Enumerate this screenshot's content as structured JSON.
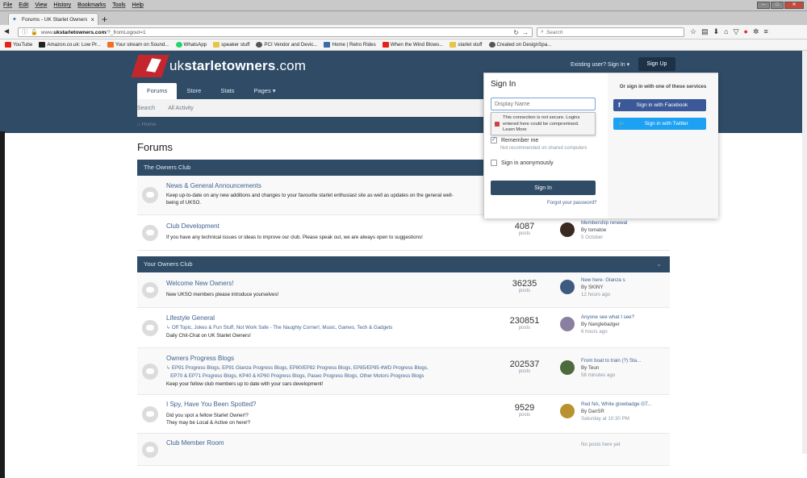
{
  "browser": {
    "menus": [
      "File",
      "Edit",
      "View",
      "History",
      "Bookmarks",
      "Tools",
      "Help"
    ],
    "tab_title": "Forums - UK Starlet Owners",
    "url_domain": "ukstarletowners.com",
    "url_prefix": "www.",
    "url_path": "/?_fromLogout=1",
    "search_placeholder": "Search",
    "bookmarks": [
      {
        "label": "YouTube",
        "color": "#e62117"
      },
      {
        "label": "Amazon.co.uk: Low Pr...",
        "color": "#222222"
      },
      {
        "label": "Your stream on Sound...",
        "color": "#f26f23"
      },
      {
        "label": "WhatsApp",
        "color": "#25d366"
      },
      {
        "label": "speaker stuff",
        "color": "#e8c44a"
      },
      {
        "label": "PCI Vendor and Devic...",
        "color": "#555555"
      },
      {
        "label": "Home | Retro Rides",
        "color": "#3a6ea5"
      },
      {
        "label": "When the Wind Blows...",
        "color": "#e62117"
      },
      {
        "label": "starlet stuff",
        "color": "#e8c44a"
      },
      {
        "label": "Created on DesignSpa...",
        "color": "#555555"
      }
    ]
  },
  "site": {
    "logo_text_a": "uk",
    "logo_text_b": "starletowners",
    "logo_text_c": ".com",
    "existing_user": "Existing user? Sign In ▾",
    "signup": "Sign Up",
    "navtabs": [
      "Forums",
      "Store",
      "Stats",
      "Pages ▾"
    ],
    "subnav": [
      "Search",
      "All Activity"
    ],
    "breadcrumb": "⌂ Home",
    "page_title": "Forums"
  },
  "categories": [
    {
      "title": "The Owners Club"
    },
    {
      "title": "Your Owners Club"
    }
  ],
  "forums": [
    {
      "title": "News & General Announcements",
      "desc1": "Keep up-to-date on any new additions and changes to your favourite starlet enthusiast site as well as updates on the general well-",
      "desc2": "being of UKSO.",
      "posts": "",
      "posts_label": "",
      "last_title": "",
      "last_by": "",
      "last_date": ""
    },
    {
      "title": "Club Development",
      "desc1": "If you have any technical issues or ideas to improve our club. Please speak out, we are always open to suggestions!",
      "posts": "4087",
      "posts_label": "posts",
      "last_title": "Membership renewal",
      "last_by": "By tomatoe",
      "last_date": "5 October"
    },
    {
      "title": "Welcome New Owners!",
      "desc1": "New UKSO members please introduce yourselves!",
      "posts": "36235",
      "posts_label": "posts",
      "last_title": "New here- Glanza s",
      "last_by": "By SKINY",
      "last_date": "12 hours ago"
    },
    {
      "title": "Lifestyle General",
      "sub1": "Off Topic,  Jokes & Fun Stuff,  Not Work Safe - The Naughty Corner!,  Music,  Games, Tech & Gadgets",
      "desc1": "Daily Chit-Chat on UK Starlet Owners!",
      "posts": "230851",
      "posts_label": "posts",
      "last_title": "Anyone see what I see?",
      "last_by": "By Nanglebadger",
      "last_date": "6 hours ago"
    },
    {
      "title": "Owners Progress Blogs",
      "sub1": "EP91 Progress Blogs,  EP91 Glanza Progress Blogs,  EP80/EP82 Progress Blogs,  EP85/EP95 4WD Progress Blogs,",
      "sub2": "EP70 & EP71 Progress Blogs,  KP40 & KP60 Progress Blogs,  Paseo Progress Blogs,  Other Motors Progress Blogs",
      "desc1": "Keep your fellow club members up to date with your cars development!",
      "posts": "202537",
      "posts_label": "posts",
      "last_title": "From boat to train (?) Sta...",
      "last_by": "By Teun",
      "last_date": "58 minutes ago"
    },
    {
      "title": "I Spy, Have You Been Spotted?",
      "desc1": "Did you spot a fellow Starlet Owner!?",
      "desc2": "They may be Local & Active on here!?",
      "posts": "9529",
      "posts_label": "posts",
      "last_title": "Red NA, White glowbadge GT...",
      "last_by": "By DanSR",
      "last_date": "Saturday at 10:30 PM"
    },
    {
      "title": "Club Member Room",
      "last_none": "No posts here yet"
    }
  ],
  "signin": {
    "title": "Sign In",
    "display_name_placeholder": "Display Name",
    "insecure_line1": "This connection is not secure. Logins",
    "insecure_line2": "entered here could be compromised.",
    "insecure_line3": "Learn More",
    "remember": "Remember me",
    "remember_note": "Not recommended on shared computers",
    "anon": "Sign in anonymously",
    "button": "Sign In",
    "forgot": "Forgot your password?",
    "or_text": "Or sign in with one of these services",
    "facebook": "Sign in with Facebook",
    "twitter": "Sign in with Twitter"
  },
  "colors": {
    "header": "#2f4b66",
    "link": "#3e6290",
    "facebook": "#3b5998",
    "twitter": "#1da1f2"
  }
}
